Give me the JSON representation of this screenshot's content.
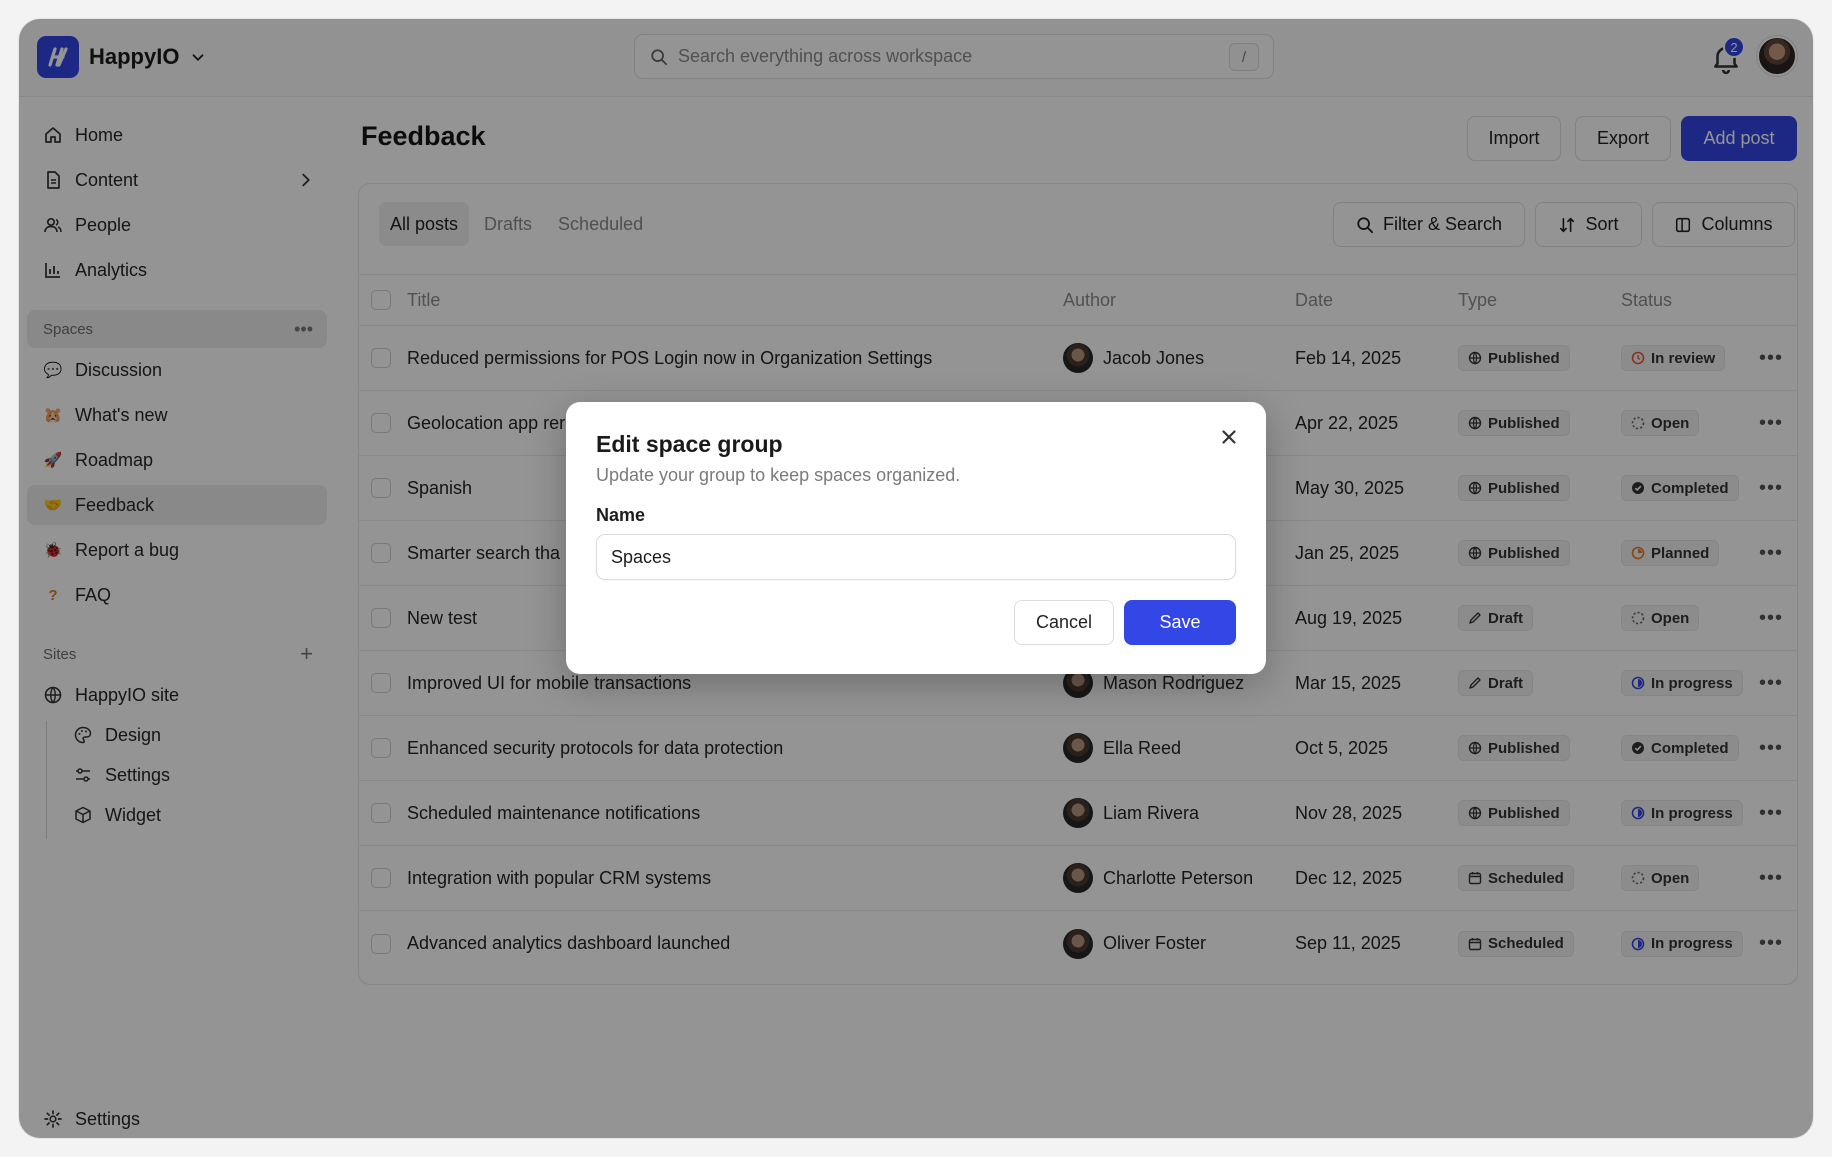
{
  "brand": {
    "name": "HappyIO"
  },
  "search": {
    "placeholder": "Search everything across workspace",
    "shortcut": "/"
  },
  "notifications": {
    "count": "2"
  },
  "sidebar": {
    "nav": [
      {
        "label": "Home"
      },
      {
        "label": "Content"
      },
      {
        "label": "People"
      },
      {
        "label": "Analytics"
      }
    ],
    "spaces_header": "Spaces",
    "spaces": [
      {
        "label": "Discussion",
        "icon": "💬"
      },
      {
        "label": "What's new",
        "icon": "🐹"
      },
      {
        "label": "Roadmap",
        "icon": "🚀"
      },
      {
        "label": "Feedback",
        "icon": "🤝"
      },
      {
        "label": "Report a bug",
        "icon": "🐞"
      },
      {
        "label": "FAQ",
        "icon": "?"
      }
    ],
    "sites_header": "Sites",
    "site": {
      "label": "HappyIO site"
    },
    "site_children": [
      {
        "label": "Design"
      },
      {
        "label": "Settings"
      },
      {
        "label": "Widget"
      }
    ],
    "footer_settings": "Settings"
  },
  "page": {
    "title": "Feedback",
    "import_label": "Import",
    "export_label": "Export",
    "add_label": "Add post"
  },
  "tabs": [
    {
      "label": "All posts"
    },
    {
      "label": "Drafts"
    },
    {
      "label": "Scheduled"
    }
  ],
  "toolbar": {
    "filter_label": "Filter & Search",
    "sort_label": "Sort",
    "columns_label": "Columns"
  },
  "table": {
    "columns": [
      "Title",
      "Author",
      "Date",
      "Type",
      "Status"
    ],
    "rows": [
      {
        "title": "Reduced permissions for POS Login now in Organization Settings",
        "author": "Jacob Jones",
        "date": "Feb 14, 2025",
        "type": "Published",
        "status": "In review"
      },
      {
        "title": "Geolocation app rer",
        "author": "",
        "date": "Apr 22, 2025",
        "type": "Published",
        "status": "Open"
      },
      {
        "title": "Spanish",
        "author": "",
        "date": "May 30, 2025",
        "type": "Published",
        "status": "Completed"
      },
      {
        "title": "Smarter search tha",
        "author": "",
        "date": "Jan 25, 2025",
        "type": "Published",
        "status": "Planned"
      },
      {
        "title": "New test",
        "author": "",
        "date": "Aug 19, 2025",
        "type": "Draft",
        "status": "Open"
      },
      {
        "title": "Improved UI for mobile transactions",
        "author": "Mason Rodriguez",
        "date": "Mar 15, 2025",
        "type": "Draft",
        "status": "In progress"
      },
      {
        "title": "Enhanced security protocols for data protection",
        "author": "Ella Reed",
        "date": "Oct 5, 2025",
        "type": "Published",
        "status": "Completed"
      },
      {
        "title": "Scheduled maintenance notifications",
        "author": "Liam Rivera",
        "date": "Nov 28, 2025",
        "type": "Published",
        "status": "In progress"
      },
      {
        "title": "Integration with popular CRM systems",
        "author": "Charlotte Peterson",
        "date": "Dec 12, 2025",
        "type": "Scheduled",
        "status": "Open"
      },
      {
        "title": "Advanced analytics dashboard launched",
        "author": "Oliver Foster",
        "date": "Sep 11, 2025",
        "type": "Scheduled",
        "status": "In progress"
      }
    ]
  },
  "modal": {
    "title": "Edit space group",
    "subtitle": "Update your group to keep spaces organized.",
    "name_label": "Name",
    "name_value": "Spaces",
    "cancel_label": "Cancel",
    "save_label": "Save"
  },
  "colors": {
    "accent": "#3346e6",
    "overlay": "rgba(0,0,0,0.42)"
  }
}
